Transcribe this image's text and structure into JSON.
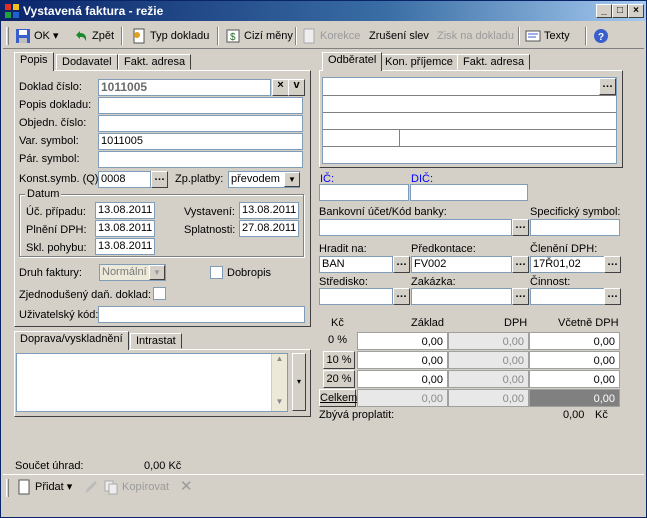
{
  "window": {
    "title": "Vystavená faktura - režie"
  },
  "toolbar": {
    "ok": "OK",
    "back": "Zpět",
    "doc_type": "Typ dokladu",
    "foreign_currency": "Cizí měny",
    "correction": "Korekce",
    "cancel_discount": "Zrušení slev",
    "profit": "Zisk na dokladu",
    "texts": "Texty"
  },
  "left_tabs": [
    "Popis",
    "Dodavatel",
    "Fakt. adresa"
  ],
  "form": {
    "doc_number_label": "Doklad číslo:",
    "doc_number": "1011005",
    "doc_desc_label": "Popis dokladu:",
    "doc_desc": "",
    "order_label": "Objedn. číslo:",
    "order": "",
    "var_symbol_label": "Var. symbol:",
    "var_symbol": "1011005",
    "pair_symbol_label": "Pár. symbol:",
    "pair_symbol": "",
    "const_symbol_label": "Konst.symb. (Q):",
    "const_symbol": "0008",
    "payment_label": "Zp.platby:",
    "payment": "převodem"
  },
  "dates": {
    "title": "Datum",
    "uc_label": "Úč. případu:",
    "uc": "13.08.2011",
    "dph_label": "Plnění DPH:",
    "dph": "13.08.2011",
    "skl_label": "Skl. pohybu:",
    "skl": "13.08.2011",
    "issued_label": "Vystavení:",
    "issued": "13.08.2011",
    "due_label": "Splatnosti:",
    "due": "27.08.2011"
  },
  "invoice": {
    "type_label": "Druh faktury:",
    "type": "Normální",
    "credit_note": "Dobropis",
    "simplified_label": "Zjednodušený daň. doklad:",
    "user_code_label": "Uživatelský kód:",
    "user_code": ""
  },
  "bottom_tabs": [
    "Doprava/vyskladnění",
    "Intrastat"
  ],
  "summary": {
    "payments_label": "Součet úhrad:",
    "payments_value": "0,00 Kč"
  },
  "bottom_toolbar": {
    "add": "Přidat",
    "copy": "Kopírovat"
  },
  "right_tabs": [
    "Odběratel",
    "Kon. příjemce",
    "Fakt. adresa"
  ],
  "customer": {
    "ic_label": "IČ:",
    "dic_label": "DIČ:",
    "bank_label": "Bankovní účet/Kód banky:",
    "spec_symbol_label": "Specifický symbol:",
    "pay_to_label": "Hradit na:",
    "pay_to": "BAN",
    "precontact_label": "Předkontace:",
    "precontact": "FV002",
    "vat_class_label": "Členění DPH:",
    "vat_class": "17Ř01,02",
    "center_label": "Středisko:",
    "order_label": "Zakázka:",
    "activity_label": "Činnost:"
  },
  "vat_table": {
    "headers": [
      "Kč",
      "Základ",
      "DPH",
      "Včetně DPH"
    ],
    "rows": [
      {
        "label": "0 %",
        "base": "0,00",
        "vat": "0,00",
        "total": "0,00"
      },
      {
        "label": "10 %",
        "base": "0,00",
        "vat": "0,00",
        "total": "0,00"
      },
      {
        "label": "20 %",
        "base": "0,00",
        "vat": "0,00",
        "total": "0,00"
      },
      {
        "label": "Celkem",
        "base": "0,00",
        "vat": "0,00",
        "total": "0,00"
      }
    ],
    "remaining_label": "Zbývá proplatit:",
    "remaining_value": "0,00",
    "remaining_currency": "Kč"
  }
}
